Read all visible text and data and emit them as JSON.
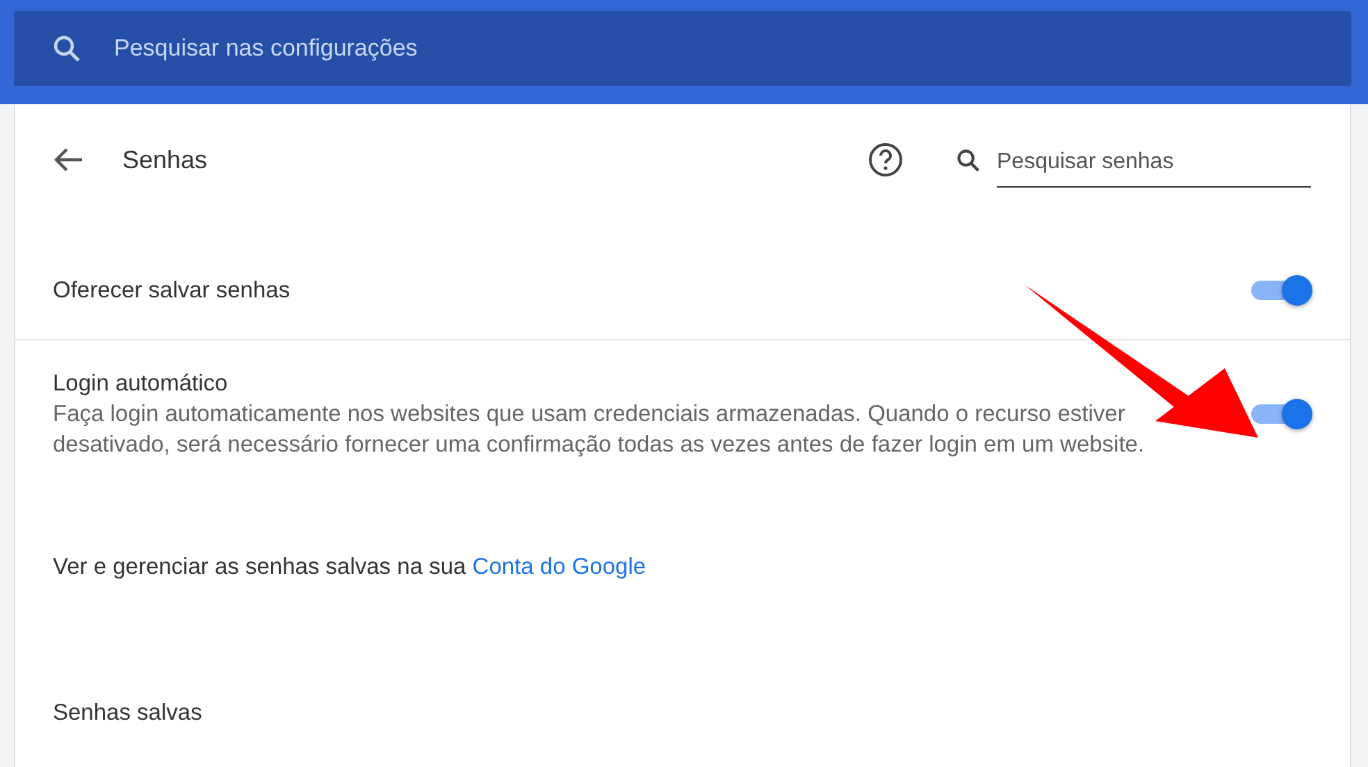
{
  "top_search": {
    "placeholder": "Pesquisar nas configurações"
  },
  "header": {
    "title": "Senhas",
    "search": {
      "placeholder": "Pesquisar senhas"
    }
  },
  "settings": [
    {
      "title": "Oferecer salvar senhas",
      "on": true
    },
    {
      "title": "Login automático",
      "description": "Faça login automaticamente nos websites que usam credenciais armazenadas. Quando o recurso estiver desativado, será necessário fornecer uma confirmação todas as vezes antes de fazer login em um website.",
      "on": true
    }
  ],
  "manage": {
    "text": "Ver e gerenciar as senhas salvas na sua",
    "link": "Conta do Google"
  },
  "section_title": "Senhas salvas"
}
